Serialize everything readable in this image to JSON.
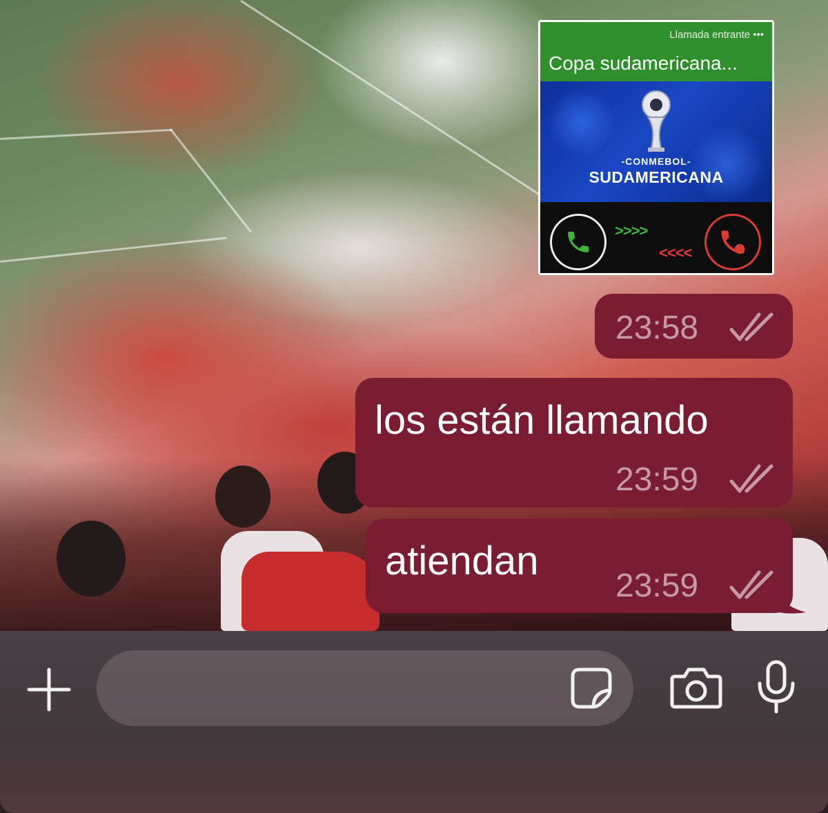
{
  "call_card": {
    "status": "Llamada entrante",
    "caller_name": "Copa sudamericana...",
    "logo_line1": "-CONMEBOL-",
    "logo_line2": "SUDAMERICANA",
    "accept_icon": "phone-accept-icon",
    "reject_icon": "phone-reject-icon",
    "accept_color": "#3eb43b",
    "reject_color": "#e03a34",
    "header_color": "#2f8f2d"
  },
  "messages": [
    {
      "text": "",
      "time": "23:58",
      "status": "read"
    },
    {
      "text": "los están llamando",
      "time": "23:59",
      "status": "read"
    },
    {
      "text": "atiendan",
      "time": "23:59",
      "status": "read"
    }
  ],
  "composer": {
    "text_value": "",
    "plus_icon": "plus-icon",
    "sticker_icon": "sticker-icon",
    "camera_icon": "camera-icon",
    "mic_icon": "microphone-icon"
  },
  "colors": {
    "bubble": "#7a1d33",
    "timestamp": "#c59aa6"
  }
}
